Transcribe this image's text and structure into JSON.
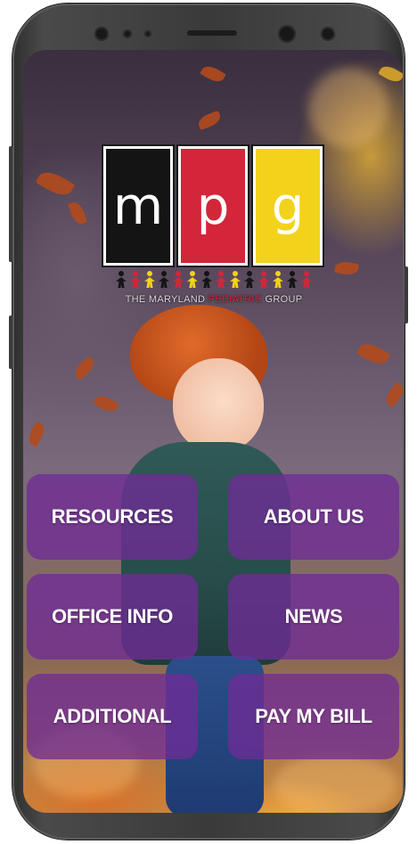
{
  "logo": {
    "letters": [
      "m",
      "p",
      "g"
    ],
    "caption_before": "THE MARYLAND ",
    "caption_highlight": "PEDIATRIC",
    "caption_after": " GROUP",
    "colors": {
      "black": "#141414",
      "red": "#d3263a",
      "yellow": "#f3d21b"
    }
  },
  "menu": {
    "resources": "RESOURCES",
    "about_us": "ABOUT US",
    "office_info": "OFFICE INFO",
    "news": "NEWS",
    "additional": "ADDITIONAL",
    "pay_my_bill": "PAY MY BILL"
  },
  "theme": {
    "button_color": "#6f2c96",
    "button_text": "#ffffff"
  },
  "icons": {
    "front_camera": "camera-icon",
    "sensor": "sensor-icon"
  }
}
